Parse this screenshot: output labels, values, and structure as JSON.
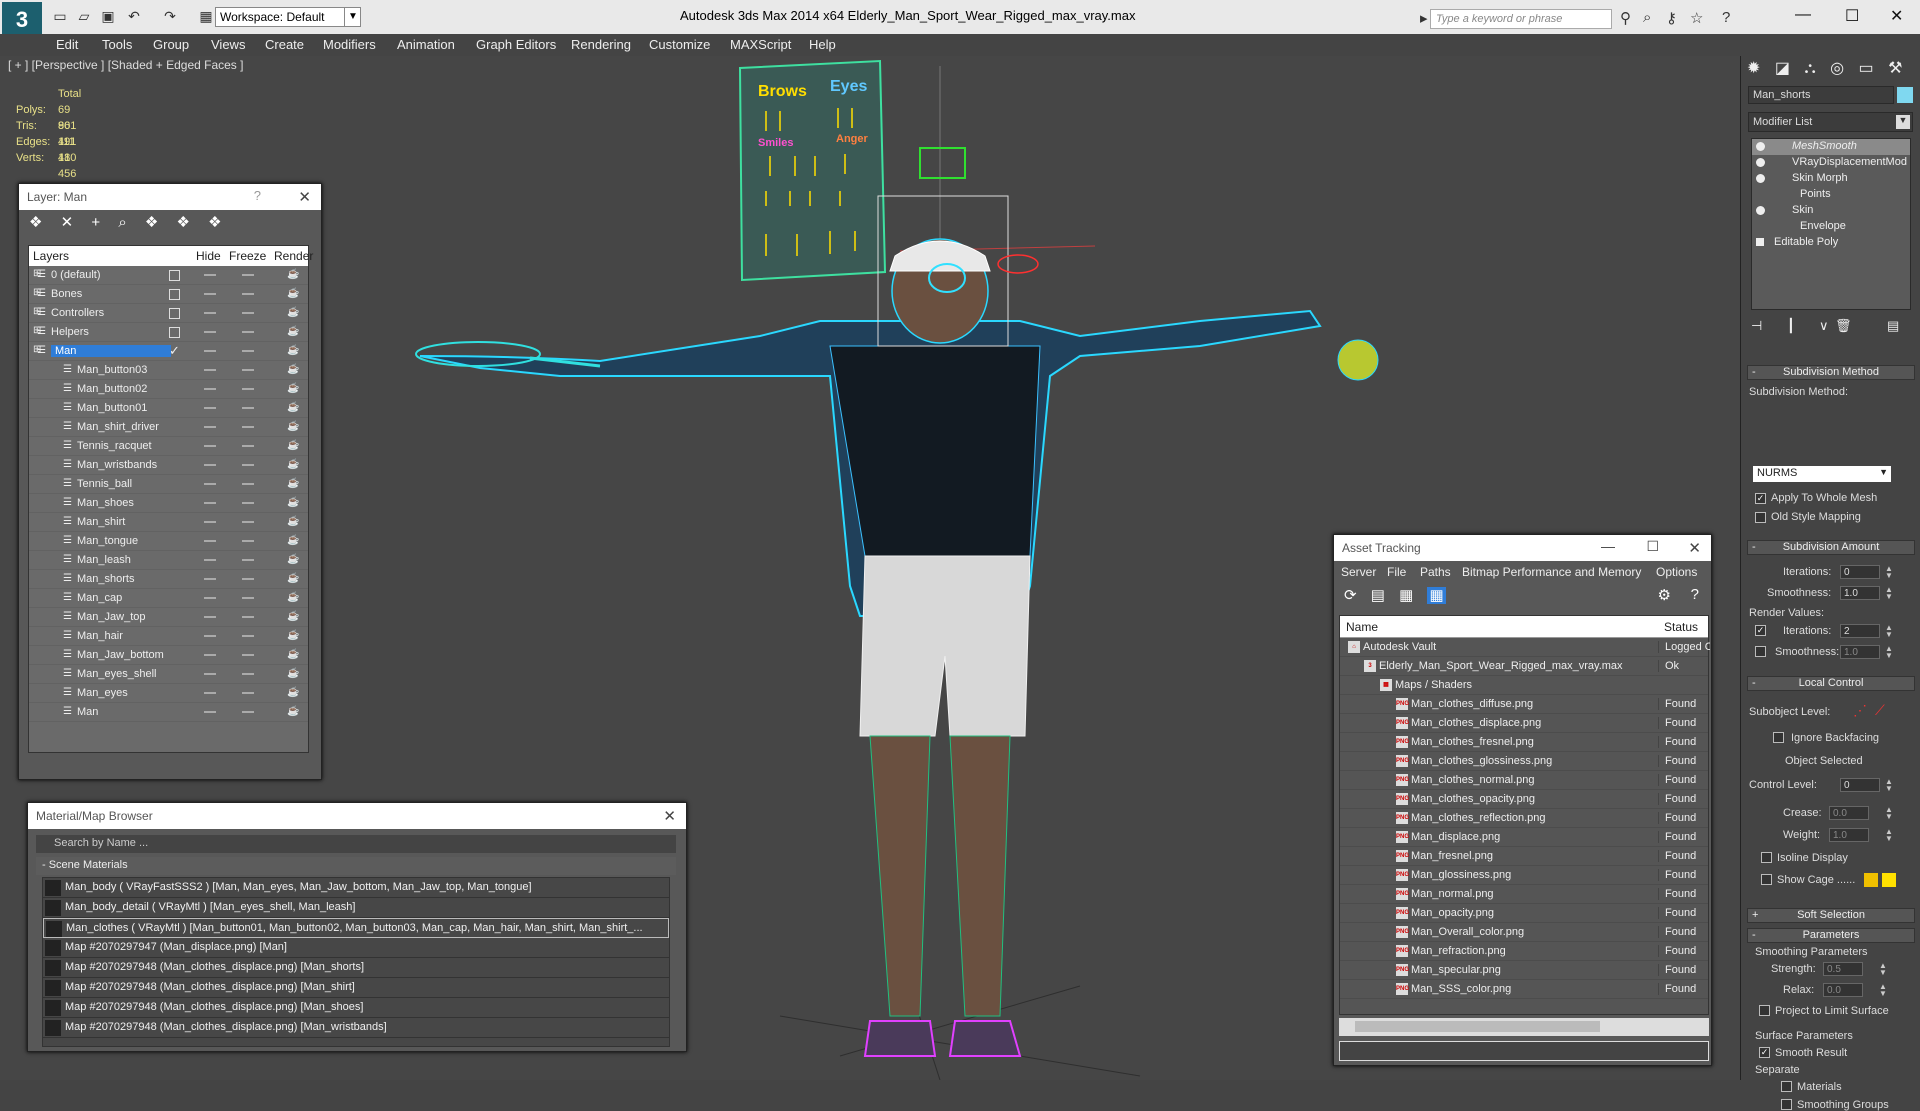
{
  "app": {
    "window_title": "Autodesk 3ds Max  2014 x64      Elderly_Man_Sport_Wear_Rigged_max_vray.max",
    "workspace": "Workspace: Default",
    "search_placeholder": "Type a keyword or phrase"
  },
  "menu": [
    "Edit",
    "Tools",
    "Group",
    "Views",
    "Create",
    "Modifiers",
    "Animation",
    "Graph Editors",
    "Rendering",
    "Customize",
    "MAXScript",
    "Help"
  ],
  "viewport": {
    "label": "[ + ] [Perspective ] [Shaded + Edged Faces ]",
    "stats_header": "Total",
    "stats": [
      {
        "label": "Polys:",
        "value": "69 961"
      },
      {
        "label": "Tris:",
        "value": "80 491"
      },
      {
        "label": "Edges:",
        "value": "111 180"
      },
      {
        "label": "Verts:",
        "value": "41 456"
      }
    ],
    "face_panel": {
      "brows": "Brows",
      "eyes": "Eyes",
      "smiles": "Smiles",
      "anger": "Anger"
    }
  },
  "layer_window": {
    "title": "Layer: Man",
    "columns": [
      "Layers",
      "Hide",
      "Freeze",
      "Render"
    ],
    "rows": [
      {
        "name": "0 (default)",
        "level": 0,
        "checkbox": true
      },
      {
        "name": "Bones",
        "level": 0,
        "checkbox": true
      },
      {
        "name": "Controllers",
        "level": 0,
        "checkbox": true
      },
      {
        "name": "Helpers",
        "level": 0,
        "checkbox": true
      },
      {
        "name": "Man",
        "level": 0,
        "selected": true,
        "check": "✓"
      },
      {
        "name": "Man_button03",
        "level": 1
      },
      {
        "name": "Man_button02",
        "level": 1
      },
      {
        "name": "Man_button01",
        "level": 1
      },
      {
        "name": "Man_shirt_driver",
        "level": 1
      },
      {
        "name": "Tennis_racquet",
        "level": 1
      },
      {
        "name": "Man_wristbands",
        "level": 1
      },
      {
        "name": "Tennis_ball",
        "level": 1
      },
      {
        "name": "Man_shoes",
        "level": 1
      },
      {
        "name": "Man_shirt",
        "level": 1
      },
      {
        "name": "Man_tongue",
        "level": 1
      },
      {
        "name": "Man_leash",
        "level": 1
      },
      {
        "name": "Man_shorts",
        "level": 1
      },
      {
        "name": "Man_cap",
        "level": 1
      },
      {
        "name": "Man_Jaw_top",
        "level": 1
      },
      {
        "name": "Man_hair",
        "level": 1
      },
      {
        "name": "Man_Jaw_bottom",
        "level": 1
      },
      {
        "name": "Man_eyes_shell",
        "level": 1
      },
      {
        "name": "Man_eyes",
        "level": 1
      },
      {
        "name": "Man",
        "level": 1
      }
    ]
  },
  "material_browser": {
    "title": "Material/Map Browser",
    "search_placeholder": "Search by Name ...",
    "section": "- Scene Materials",
    "items": [
      "Man_body  ( VRayFastSSS2 )  [Man, Man_eyes, Man_Jaw_bottom, Man_Jaw_top, Man_tongue]",
      "Man_body_detail  ( VRayMtl )  [Man_eyes_shell, Man_leash]",
      "Man_clothes  ( VRayMtl )  [Man_button01, Man_button02, Man_button03, Man_cap, Man_hair, Man_shirt, Man_shirt_...",
      "Map #2070297947 (Man_displace.png)  [Man]",
      "Map #2070297948 (Man_clothes_displace.png)  [Man_shorts]",
      "Map #2070297948 (Man_clothes_displace.png)  [Man_shirt]",
      "Map #2070297948 (Man_clothes_displace.png)  [Man_shoes]",
      "Map #2070297948 (Man_clothes_displace.png)  [Man_wristbands]"
    ],
    "selected_index": 2
  },
  "asset_tracking": {
    "title": "Asset Tracking",
    "menu": [
      "Server",
      "File",
      "Paths",
      "Bitmap Performance and Memory",
      "Options"
    ],
    "columns": [
      "Name",
      "Status"
    ],
    "rows": [
      {
        "name": "Autodesk Vault",
        "status": "Logged O",
        "level": 0,
        "icon": "vault"
      },
      {
        "name": "Elderly_Man_Sport_Wear_Rigged_max_vray.max",
        "status": "Ok",
        "level": 1,
        "icon": "max"
      },
      {
        "name": "Maps / Shaders",
        "status": "",
        "level": 2,
        "icon": "maps"
      },
      {
        "name": "Man_clothes_diffuse.png",
        "status": "Found",
        "level": 3,
        "icon": "png"
      },
      {
        "name": "Man_clothes_displace.png",
        "status": "Found",
        "level": 3,
        "icon": "png"
      },
      {
        "name": "Man_clothes_fresnel.png",
        "status": "Found",
        "level": 3,
        "icon": "png"
      },
      {
        "name": "Man_clothes_glossiness.png",
        "status": "Found",
        "level": 3,
        "icon": "png"
      },
      {
        "name": "Man_clothes_normal.png",
        "status": "Found",
        "level": 3,
        "icon": "png"
      },
      {
        "name": "Man_clothes_opacity.png",
        "status": "Found",
        "level": 3,
        "icon": "png"
      },
      {
        "name": "Man_clothes_reflection.png",
        "status": "Found",
        "level": 3,
        "icon": "png"
      },
      {
        "name": "Man_displace.png",
        "status": "Found",
        "level": 3,
        "icon": "png"
      },
      {
        "name": "Man_fresnel.png",
        "status": "Found",
        "level": 3,
        "icon": "png"
      },
      {
        "name": "Man_glossiness.png",
        "status": "Found",
        "level": 3,
        "icon": "png"
      },
      {
        "name": "Man_normal.png",
        "status": "Found",
        "level": 3,
        "icon": "png"
      },
      {
        "name": "Man_opacity.png",
        "status": "Found",
        "level": 3,
        "icon": "png"
      },
      {
        "name": "Man_Overall_color.png",
        "status": "Found",
        "level": 3,
        "icon": "png"
      },
      {
        "name": "Man_refraction.png",
        "status": "Found",
        "level": 3,
        "icon": "png"
      },
      {
        "name": "Man_specular.png",
        "status": "Found",
        "level": 3,
        "icon": "png"
      },
      {
        "name": "Man_SSS_color.png",
        "status": "Found",
        "level": 3,
        "icon": "png"
      }
    ]
  },
  "command_panel": {
    "object_name": "Man_shorts",
    "modifier_list": "Modifier List",
    "stack": [
      "MeshSmooth",
      "VRayDisplacementMod",
      "Skin Morph",
      "Points",
      "Skin",
      "Envelope",
      "Editable Poly"
    ],
    "subdivision_method_header": "Subdivision Method",
    "subdivision_method_label": "Subdivision Method:",
    "subdivision_method_value": "NURMS",
    "apply_whole_mesh": "Apply To Whole Mesh",
    "old_style_mapping": "Old Style Mapping",
    "subdivision_amount_header": "Subdivision Amount",
    "iterations_label": "Iterations:",
    "iterations_value": "0",
    "smoothness_label": "Smoothness:",
    "smoothness_value": "1.0",
    "render_values_label": "Render Values:",
    "render_iterations_label": "Iterations:",
    "render_iterations_value": "2",
    "render_smoothness_label": "Smoothness:",
    "render_smoothness_value": "1.0",
    "local_control_header": "Local Control",
    "subobject_level_label": "Subobject Level:",
    "ignore_backfacing": "Ignore Backfacing",
    "object_selected": "Object Selected",
    "control_level_label": "Control Level:",
    "control_level_value": "0",
    "crease_label": "Crease:",
    "crease_value": "0.0",
    "weight_label": "Weight:",
    "weight_value": "1.0",
    "isoline_display": "Isoline Display",
    "show_cage": "Show Cage ......",
    "soft_selection_header": "Soft Selection",
    "parameters_header": "Parameters",
    "smoothing_params": "Smoothing Parameters",
    "strength_label": "Strength:",
    "strength_value": "0.5",
    "relax_label": "Relax:",
    "relax_value": "0.0",
    "project_limit": "Project to Limit Surface",
    "surface_params": "Surface Parameters",
    "smooth_result": "Smooth Result",
    "separate": "Separate",
    "materials": "Materials",
    "smoothing_groups": "Smoothing Groups"
  },
  "colors": {
    "accent": "#2f7dd8",
    "cage_a": "#f0c000",
    "cage_b": "#ffe000",
    "object_color": "#7fd8f0"
  }
}
